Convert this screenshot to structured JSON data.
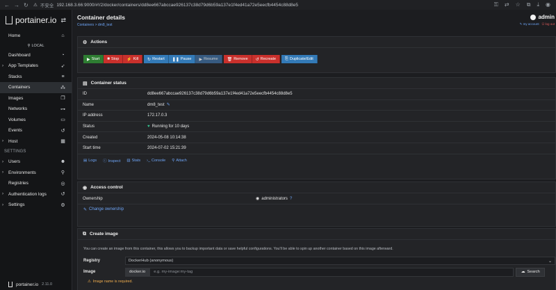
{
  "browser": {
    "insecure_label": "不安全",
    "url": "192.168.3.66:9000/#!/2/docker/containers/dd8ee667abccae926137c38d79d6b59a137e1f4ed41a72e5eecfb4454c88d8e5"
  },
  "sidebar": {
    "brand": "portainer.io",
    "home": "Home",
    "env_label": "LOCAL",
    "items": [
      {
        "label": "Dashboard",
        "icon": "dashboard-icon"
      },
      {
        "label": "App Templates",
        "icon": "rocket-icon"
      },
      {
        "label": "Stacks",
        "icon": "stack-icon"
      },
      {
        "label": "Containers",
        "icon": "cubes-icon"
      },
      {
        "label": "Images",
        "icon": "clone-icon"
      },
      {
        "label": "Networks",
        "icon": "sitemap-icon"
      },
      {
        "label": "Volumes",
        "icon": "hdd-icon"
      },
      {
        "label": "Events",
        "icon": "history-icon"
      },
      {
        "label": "Host",
        "icon": "th-icon"
      }
    ],
    "settings_heading": "SETTINGS",
    "settings_items": [
      {
        "label": "Users",
        "icon": "users-icon"
      },
      {
        "label": "Environments",
        "icon": "plug-icon"
      },
      {
        "label": "Registries",
        "icon": "database-icon"
      },
      {
        "label": "Authentication logs",
        "icon": "history-icon"
      },
      {
        "label": "Settings",
        "icon": "cogs-icon"
      }
    ],
    "footer_brand": "portainer.io",
    "version": "2.11.0"
  },
  "header": {
    "title": "Container details",
    "breadcrumb_link": "Containers",
    "breadcrumb_sep": " > ",
    "breadcrumb_current": "dm8_test",
    "user": "admin",
    "my_account": "my account",
    "log_out": "log out"
  },
  "actions": {
    "title": "Actions",
    "buttons": [
      {
        "label": "Start",
        "icon": "▶",
        "color": "#2e7d32"
      },
      {
        "label": "Stop",
        "icon": "■",
        "color": "#c9302c"
      },
      {
        "label": "Kill",
        "icon": "⚡",
        "color": "#c9302c"
      },
      {
        "label": "Restart",
        "icon": "↻",
        "color": "#337ab7"
      },
      {
        "label": "Pause",
        "icon": "❚❚",
        "color": "#337ab7"
      },
      {
        "label": "Resume",
        "icon": "▶",
        "color": "#3e6ea0"
      },
      {
        "label": "Remove",
        "icon": "🗑",
        "color": "#c9302c"
      },
      {
        "label": "Recreate",
        "icon": "↺",
        "color": "#c9302c"
      },
      {
        "label": "Duplicate/Edit",
        "icon": "⎘",
        "color": "#337ab7"
      }
    ]
  },
  "status": {
    "title": "Container status",
    "rows": [
      {
        "key": "ID",
        "value": "dd8ee667abccae926137c38d79d6b59a137e1f4ed41a72e5eecfb4454c88d8e5"
      },
      {
        "key": "Name",
        "value": "dm8_test"
      },
      {
        "key": "IP address",
        "value": "172.17.0.3"
      },
      {
        "key": "Status",
        "value": "Running for 10 days"
      },
      {
        "key": "Created",
        "value": "2024-05-08 10:14:38"
      },
      {
        "key": "Start time",
        "value": "2024-07-02 15:21:39"
      }
    ],
    "links": [
      "Logs",
      "Inspect",
      "Stats",
      "Console",
      "Attach"
    ],
    "status_color": "#34c38f"
  },
  "access": {
    "title": "Access control",
    "ownership_label": "Ownership",
    "ownership_value": "administrators",
    "change_label": "Change ownership"
  },
  "create_image": {
    "title": "Create image",
    "description": "You can create an image from this container, this allows you to backup important data or save helpful configurations. You'll be able to spin up another container based on this image afterward.",
    "registry_label": "Registry",
    "registry_value": "DockerHub (anonymous)",
    "image_label": "Image",
    "image_prefix": "docker.io",
    "image_placeholder": "e.g. my-image:my-tag",
    "search_label": "Search",
    "warning": "Image name is required."
  },
  "colors": {
    "link": "#6ea5f7",
    "danger": "#c9302c",
    "primary": "#337ab7",
    "success": "#2e7d32",
    "warning": "#f0ad4e"
  }
}
